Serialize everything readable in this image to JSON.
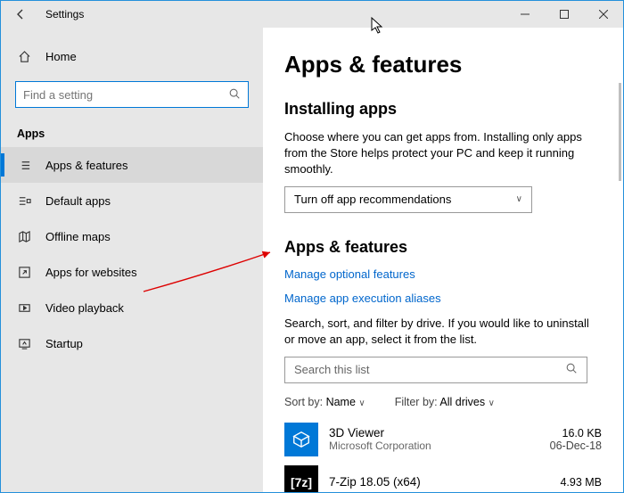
{
  "title": "Settings",
  "home_label": "Home",
  "search_placeholder": "Find a setting",
  "section": "Apps",
  "nav": [
    {
      "label": "Apps & features"
    },
    {
      "label": "Default apps"
    },
    {
      "label": "Offline maps"
    },
    {
      "label": "Apps for websites"
    },
    {
      "label": "Video playback"
    },
    {
      "label": "Startup"
    }
  ],
  "main": {
    "h1": "Apps & features",
    "install_heading": "Installing apps",
    "install_desc": "Choose where you can get apps from. Installing only apps from the Store helps protect your PC and keep it running smoothly.",
    "install_dropdown": "Turn off app recommendations",
    "af_heading": "Apps & features",
    "link1": "Manage optional features",
    "link2": "Manage app execution aliases",
    "af_desc": "Search, sort, and filter by drive. If you would like to uninstall or move an app, select it from the list.",
    "search_list_placeholder": "Search this list",
    "sort_label": "Sort by:",
    "sort_val": "Name",
    "filter_label": "Filter by:",
    "filter_val": "All drives",
    "apps": [
      {
        "name": "3D Viewer",
        "publisher": "Microsoft Corporation",
        "size": "16.0 KB",
        "date": "06-Dec-18"
      },
      {
        "name": "7-Zip 18.05 (x64)",
        "publisher": "",
        "size": "4.93 MB",
        "date": ""
      }
    ]
  }
}
